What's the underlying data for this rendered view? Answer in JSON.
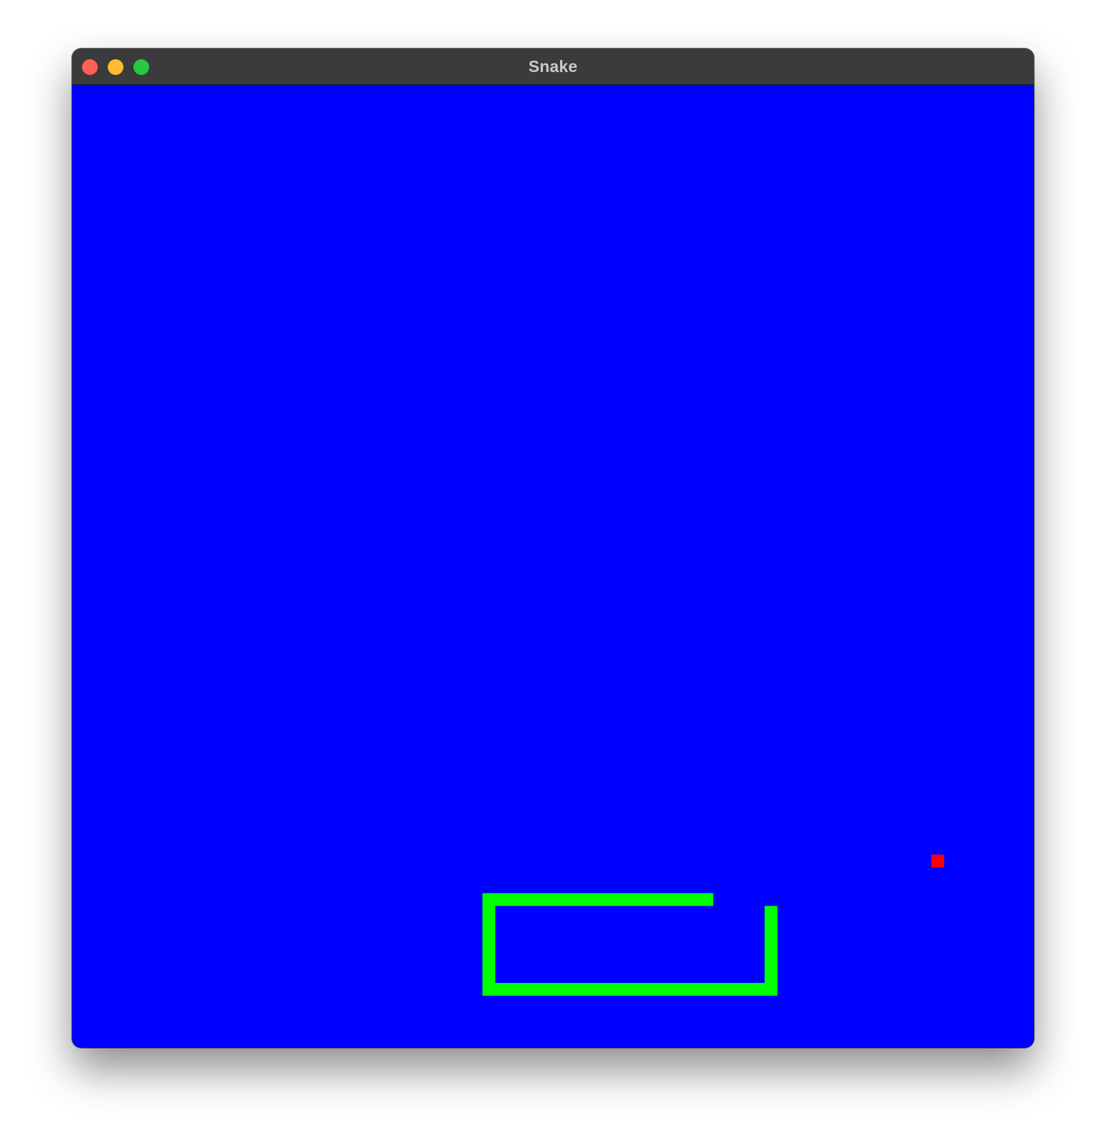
{
  "window": {
    "title": "Snake"
  },
  "colors": {
    "titlebar": "#3b3a3d",
    "title_text": "#c9c8cb",
    "background": "#0000ff",
    "snake": "#00ff00",
    "food": "#ff0000",
    "close": "#fe5f57",
    "minimize": "#febc2e",
    "zoom": "#28c840"
  },
  "game": {
    "grid_cells": 75,
    "snake_path": [
      [
        54,
        64
      ],
      [
        54,
        70
      ],
      [
        32,
        70
      ],
      [
        32,
        63
      ],
      [
        49,
        63
      ]
    ],
    "food": [
      67,
      60
    ]
  }
}
